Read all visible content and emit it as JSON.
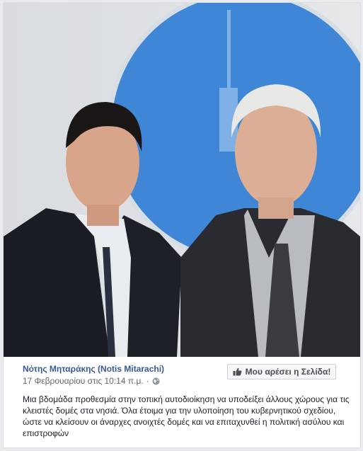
{
  "post": {
    "page_name": "Νότης Μηταράκης (Notis Mitarachi)",
    "timestamp": "17 Φεβρουαρίου στις 10:14 π.μ.",
    "separator": "·",
    "privacy_icon": "globe-icon",
    "like_page_label": "Μου αρέσει η Σελίδα!",
    "like_icon": "thumbs-up-icon",
    "text_lines": [
      "Μια βδομάδα προθεσμία στην τοπική αυτοδιοίκηση να υποδείξει άλλους χώρους για τις",
      "κλειστές δομές στα νησιά. Όλα έτοιμα για την υλοποίηση του κυβερνητικού σχεδίου,",
      "ώστε να κλείσουν οι άναρχες ανοιχτές δομές και να επιταχυνθεί η πολιτική ασύλου και",
      "επιστροφών"
    ]
  },
  "colors": {
    "link": "#365899",
    "meta_text": "#616770",
    "body_text": "#1d2129",
    "backdrop_blue": "#3f86d6"
  }
}
